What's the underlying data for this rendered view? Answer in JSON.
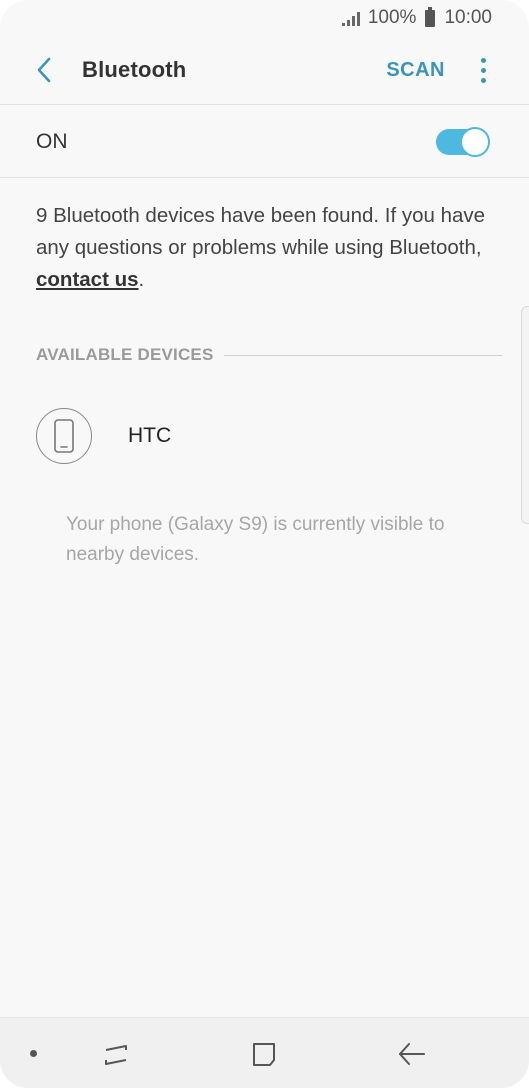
{
  "status_bar": {
    "battery": "100%",
    "time": "10:00"
  },
  "app_bar": {
    "title": "Bluetooth",
    "scan_label": "SCAN"
  },
  "toggle": {
    "label": "ON",
    "state": true
  },
  "info": {
    "text": "9 Bluetooth devices have been found. If you have any questions or problems while using Bluetooth, ",
    "link": "contact us",
    "suffix": "."
  },
  "available_devices": {
    "header": "AVAILABLE DEVICES",
    "items": [
      {
        "name": "HTC",
        "icon": "smartphone-icon"
      }
    ]
  },
  "visibility_note": "Your phone (Galaxy S9) is currently visible to nearby devices.",
  "colors": {
    "accent": "#3a96b8",
    "toggle_on": "#4fb8e0",
    "background": "#f8f8f8"
  },
  "nav_bar": {
    "icons": [
      "nav-dot-icon",
      "recent-apps-icon",
      "home-icon",
      "back-icon"
    ]
  }
}
